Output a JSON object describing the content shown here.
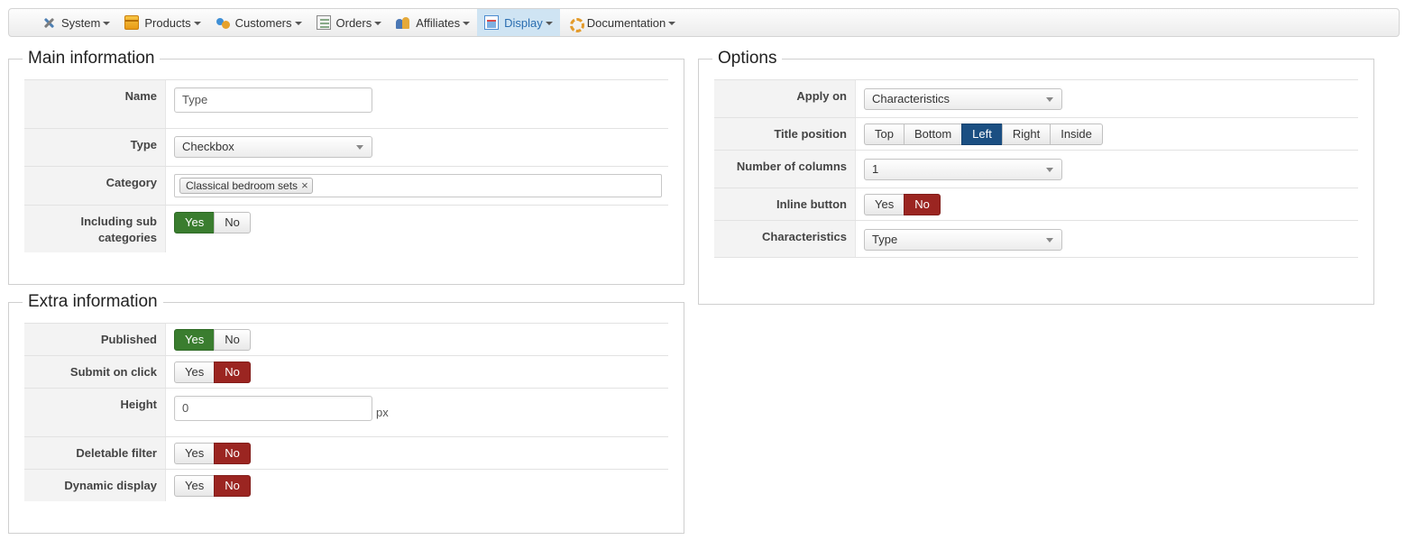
{
  "menu": [
    {
      "label": "System",
      "icon": "wrench-screwdriver-icon",
      "active": false
    },
    {
      "label": "Products",
      "icon": "box-icon",
      "active": false
    },
    {
      "label": "Customers",
      "icon": "users-icon",
      "active": false
    },
    {
      "label": "Orders",
      "icon": "order-list-icon",
      "active": false
    },
    {
      "label": "Affiliates",
      "icon": "affiliates-icon",
      "active": false
    },
    {
      "label": "Display",
      "icon": "display-window-icon",
      "active": true
    },
    {
      "label": "Documentation",
      "icon": "lifebuoy-icon",
      "active": false
    }
  ],
  "main_information": {
    "legend": "Main information",
    "name": {
      "label": "Name",
      "value": "Type"
    },
    "type": {
      "label": "Type",
      "value": "Checkbox"
    },
    "category": {
      "label": "Category",
      "tag": "Classical bedroom sets",
      "remove": "×"
    },
    "including_sub": {
      "label": "Including sub categories",
      "yes": "Yes",
      "no": "No",
      "selected": "Yes"
    }
  },
  "extra_information": {
    "legend": "Extra information",
    "published": {
      "label": "Published",
      "yes": "Yes",
      "no": "No",
      "selected": "Yes"
    },
    "submit_on_click": {
      "label": "Submit on click",
      "yes": "Yes",
      "no": "No",
      "selected": "No"
    },
    "height": {
      "label": "Height",
      "value": "0",
      "unit": "px"
    },
    "deletable_filter": {
      "label": "Deletable filter",
      "yes": "Yes",
      "no": "No",
      "selected": "No"
    },
    "dynamic_display": {
      "label": "Dynamic display",
      "yes": "Yes",
      "no": "No",
      "selected": "No"
    }
  },
  "options": {
    "legend": "Options",
    "apply_on": {
      "label": "Apply on",
      "value": "Characteristics"
    },
    "title_position": {
      "label": "Title position",
      "choices": [
        "Top",
        "Bottom",
        "Left",
        "Right",
        "Inside"
      ],
      "selected": "Left"
    },
    "number_of_columns": {
      "label": "Number of columns",
      "value": "1"
    },
    "inline_button": {
      "label": "Inline button",
      "yes": "Yes",
      "no": "No",
      "selected": "No"
    },
    "characteristics": {
      "label": "Characteristics",
      "value": "Type"
    }
  },
  "colors": {
    "yes_active": "#3a7d2f",
    "no_active": "#9b2521",
    "choice_active": "#1b4f82",
    "menu_active": "#cfe4f3"
  }
}
